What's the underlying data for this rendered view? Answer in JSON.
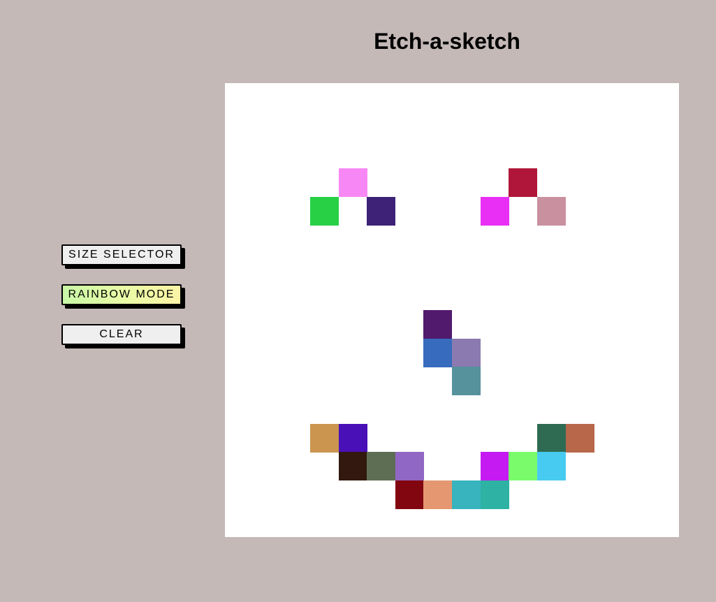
{
  "header": {
    "title": "Etch-a-sketch"
  },
  "controls": {
    "size_selector_label": "SIZE SELECTOR",
    "rainbow_mode_label": "RAINBOW MODE",
    "clear_label": "CLEAR"
  },
  "grid": {
    "background": "#ffffff",
    "columns": 16,
    "rows": 16,
    "painted_cells": [
      {
        "col": 4,
        "row": 3,
        "color": "#f887f6"
      },
      {
        "col": 3,
        "row": 4,
        "color": "#27d045"
      },
      {
        "col": 5,
        "row": 4,
        "color": "#3e2277"
      },
      {
        "col": 10,
        "row": 3,
        "color": "#b01639"
      },
      {
        "col": 9,
        "row": 4,
        "color": "#e92ef5"
      },
      {
        "col": 11,
        "row": 4,
        "color": "#c9909f"
      },
      {
        "col": 7,
        "row": 8,
        "color": "#521a6c"
      },
      {
        "col": 7,
        "row": 9,
        "color": "#376bbe"
      },
      {
        "col": 8,
        "row": 9,
        "color": "#8a7aaf"
      },
      {
        "col": 8,
        "row": 10,
        "color": "#56929c"
      },
      {
        "col": 3,
        "row": 12,
        "color": "#cb954f"
      },
      {
        "col": 4,
        "row": 12,
        "color": "#4a10b8"
      },
      {
        "col": 11,
        "row": 12,
        "color": "#2f6b53"
      },
      {
        "col": 12,
        "row": 12,
        "color": "#b9674a"
      },
      {
        "col": 4,
        "row": 13,
        "color": "#32180e"
      },
      {
        "col": 5,
        "row": 13,
        "color": "#5e6e55"
      },
      {
        "col": 6,
        "row": 13,
        "color": "#9067c4"
      },
      {
        "col": 9,
        "row": 13,
        "color": "#c51bf2"
      },
      {
        "col": 10,
        "row": 13,
        "color": "#7afb6c"
      },
      {
        "col": 11,
        "row": 13,
        "color": "#48cbf1"
      },
      {
        "col": 6,
        "row": 14,
        "color": "#82060f"
      },
      {
        "col": 7,
        "row": 14,
        "color": "#e49770"
      },
      {
        "col": 8,
        "row": 14,
        "color": "#37b4bd"
      },
      {
        "col": 9,
        "row": 14,
        "color": "#2db2a4"
      }
    ]
  }
}
